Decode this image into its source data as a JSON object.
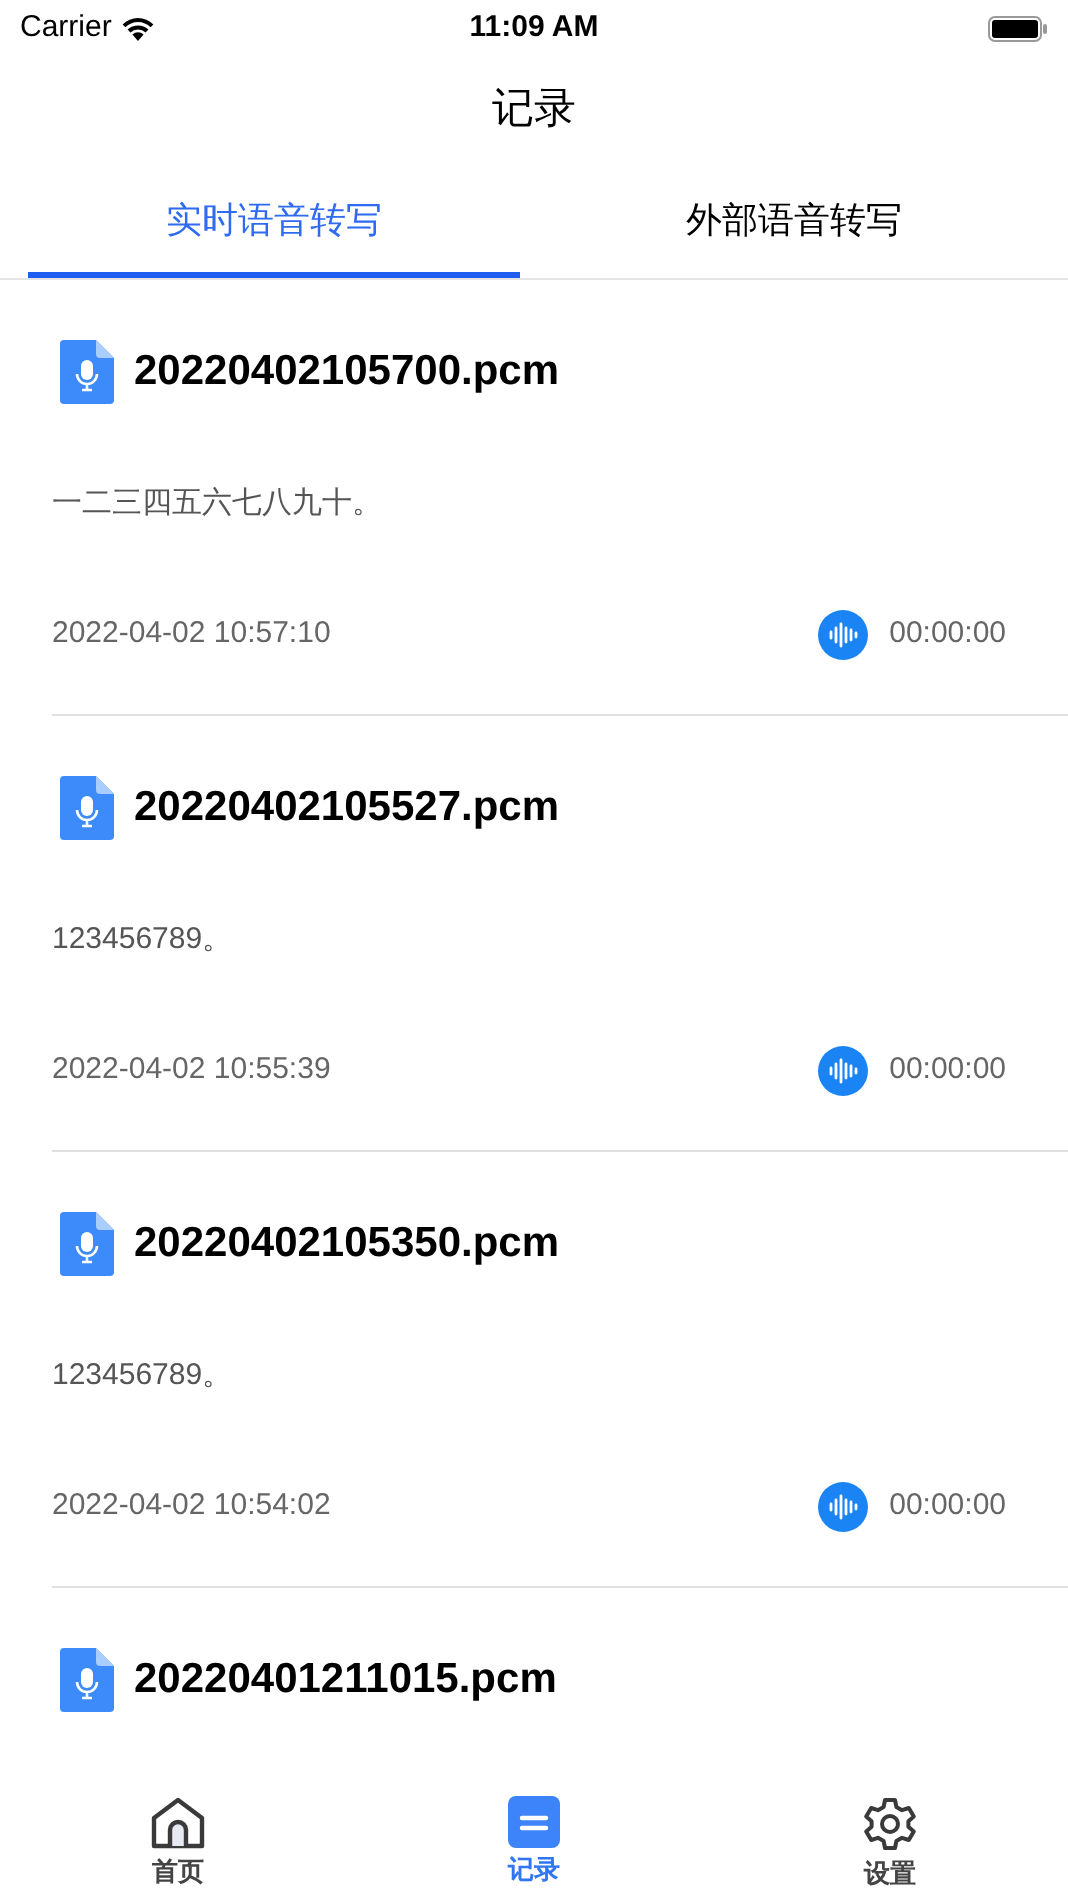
{
  "status_bar": {
    "carrier": "Carrier",
    "time": "11:09 AM"
  },
  "title": "记录",
  "tabs": [
    {
      "label": "实时语音转写",
      "selected": true
    },
    {
      "label": "外部语音转写",
      "selected": false
    }
  ],
  "records": [
    {
      "file": "20220402105700.pcm",
      "text": "一二三四五六七八九十。",
      "date": "2022-04-02 10:57:10",
      "duration": "00:00:00"
    },
    {
      "file": "20220402105527.pcm",
      "text": "123456789。",
      "date": "2022-04-02 10:55:39",
      "duration": "00:00:00"
    },
    {
      "file": "20220402105350.pcm",
      "text": "123456789。",
      "date": "2022-04-02 10:54:02",
      "duration": "00:00:00"
    },
    {
      "file": "20220401211015.pcm"
    }
  ],
  "tab_bar": [
    {
      "kind": "home",
      "label": "首页",
      "selected": false
    },
    {
      "kind": "records",
      "label": "记录",
      "selected": true
    },
    {
      "kind": "settings",
      "label": "设置",
      "selected": false
    }
  ]
}
